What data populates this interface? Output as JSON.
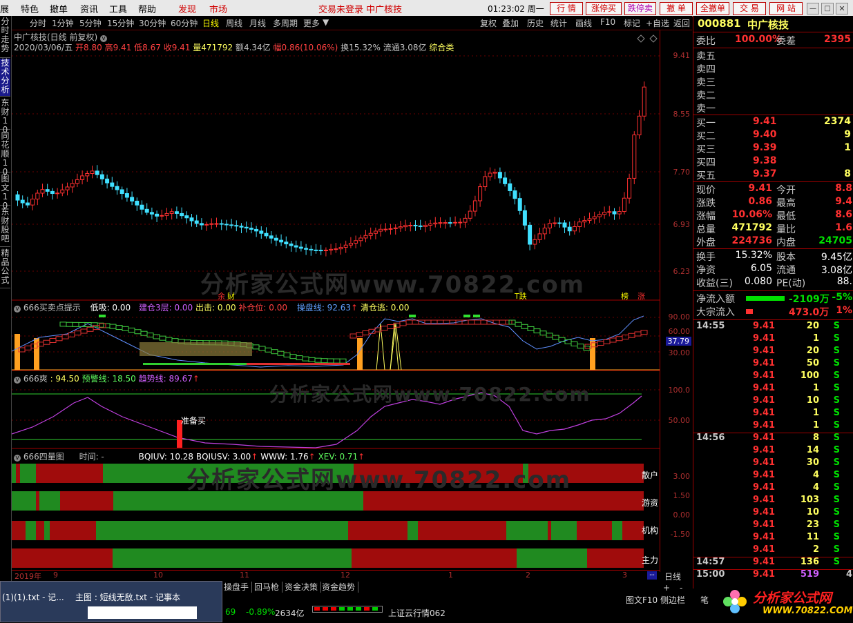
{
  "menu": {
    "items": [
      "展",
      "特色",
      "撤单",
      "资讯",
      "工具",
      "帮助"
    ],
    "red_items": [
      "发现",
      "市场"
    ],
    "notice": "交易未登录 中广核技",
    "time": "01:23:02 周一",
    "buttons": [
      "行 情",
      "涨停买",
      "跌停卖",
      "撤 单",
      "全撤单",
      "交 易",
      "网 站"
    ]
  },
  "sidebar": [
    "分时走势",
    "技术分析",
    "东财10",
    "同花顺10",
    "图文10",
    "东财股吧",
    "精品公式"
  ],
  "periods": [
    "分时",
    "1分钟",
    "5分钟",
    "15分钟",
    "30分钟",
    "60分钟",
    "日线",
    "周线",
    "月线",
    "多周期",
    "更多"
  ],
  "active_period": "日线",
  "toolbar": [
    "复权",
    "叠加",
    "历史",
    "统计",
    "画线",
    "F10",
    "标记",
    "+自选",
    "返回"
  ],
  "main_chart": {
    "title": "中广核技(日线 前复权)",
    "info": {
      "date": "2020/03/06/五",
      "open": "开8.80",
      "high": "高9.41",
      "low": "低8.67",
      "close": "收9.41",
      "vol": "量471792",
      "amount": "额4.34亿",
      "change": "幅0.86(10.06%)",
      "turnover": "换15.32%",
      "float": "流通3.08亿",
      "category": "综合类"
    },
    "yticks": [
      "9.41",
      "8.55",
      "7.70",
      "6.93",
      "6.23"
    ],
    "marks": [
      "余",
      "财",
      "T跌",
      "榜",
      "涨"
    ]
  },
  "panel1": {
    "title": "666买卖点提示",
    "items": [
      {
        "label": "低吸: 0.00",
        "color": "#ffffff"
      },
      {
        "label": "建仓3层: 0.00",
        "color": "#d060ff"
      },
      {
        "label": "出击: 0.00",
        "color": "#ffff60"
      },
      {
        "label": "补仓位: 0.00",
        "color": "#ff4040"
      },
      {
        "label": "操盘线: 92.63",
        "color": "#60a0ff"
      },
      {
        "label": "清仓逃: 0.00",
        "color": "#ffff60"
      }
    ],
    "yticks": [
      "90.00",
      "60.00",
      "37.79",
      "30.00"
    ]
  },
  "panel2": {
    "title": "666爽",
    "items": [
      {
        "label": ": 94.50",
        "color": "#ffff60"
      },
      {
        "label": "预警线: 18.50",
        "color": "#60ff60"
      },
      {
        "label": "趋势线: 89.67",
        "color": "#d060ff"
      }
    ],
    "yticks": [
      "100.0",
      "50.00"
    ],
    "signal": "准备买"
  },
  "panel3": {
    "title": "666四量图",
    "time_label": "时间: -",
    "items": [
      {
        "label": "BQIUV: 10.28",
        "color": "#ffffff"
      },
      {
        "label": "BQIUSV: 3.00",
        "color": "#ffffff"
      },
      {
        "label": "WWW: 1.76",
        "color": "#ffffff"
      },
      {
        "label": "XEV: 0.71",
        "color": "#60ff60"
      }
    ],
    "rows": [
      "散户",
      "游资",
      "机构",
      "主力"
    ],
    "yticks": [
      "3.00",
      "1.50",
      "0.00",
      "-1.50"
    ]
  },
  "xaxis": [
    "2019年",
    "9",
    "10",
    "11",
    "12",
    "1",
    "2",
    "3"
  ],
  "xaxis_corner": "日线",
  "stock": {
    "code": "000881",
    "name": "中广核技",
    "weibi_label": "委比",
    "weibi": "100.00%",
    "weicha_label": "委差",
    "weicha": "2395",
    "sells": [
      {
        "l": "卖五"
      },
      {
        "l": "卖四"
      },
      {
        "l": "卖三"
      },
      {
        "l": "卖二"
      },
      {
        "l": "卖一"
      }
    ],
    "buys": [
      {
        "l": "买一",
        "p": "9.41",
        "v": "2374"
      },
      {
        "l": "买二",
        "p": "9.40",
        "v": "9"
      },
      {
        "l": "买三",
        "p": "9.39",
        "v": "1"
      },
      {
        "l": "买四",
        "p": "9.38",
        "v": ""
      },
      {
        "l": "买五",
        "p": "9.37",
        "v": "8"
      }
    ],
    "quote": [
      {
        "l1": "现价",
        "v1": "9.41",
        "l2": "今开",
        "v2": "8.8"
      },
      {
        "l1": "涨跌",
        "v1": "0.86",
        "l2": "最高",
        "v2": "9.4"
      },
      {
        "l1": "涨幅",
        "v1": "10.06%",
        "l2": "最低",
        "v2": "8.6"
      },
      {
        "l1": "总量",
        "v1": "471792",
        "l2": "量比",
        "v2": "1.6"
      },
      {
        "l1": "外盘",
        "v1": "224736",
        "l2": "内盘",
        "v2": "24705"
      }
    ],
    "fund": [
      {
        "l1": "换手",
        "v1": "15.32%",
        "l2": "股本",
        "v2": "9.45亿"
      },
      {
        "l1": "净资",
        "v1": "6.05",
        "l2": "流通",
        "v2": "3.08亿"
      },
      {
        "l1": "收益(三)",
        "v1": "0.080",
        "l2": "PE(动)",
        "v2": "88."
      }
    ],
    "netflow_label": "净流入额",
    "netflow": "-2109万",
    "netflow_pct": "-5%",
    "big_label": "大宗流入",
    "big": "473.0万",
    "big_pct": "1%"
  },
  "ticks": [
    {
      "t": "14:55",
      "p": "9.41",
      "v": "20",
      "s": "S"
    },
    {
      "t": "",
      "p": "9.41",
      "v": "1",
      "s": "S"
    },
    {
      "t": "",
      "p": "9.41",
      "v": "20",
      "s": "S"
    },
    {
      "t": "",
      "p": "9.41",
      "v": "50",
      "s": "S"
    },
    {
      "t": "",
      "p": "9.41",
      "v": "100",
      "s": "S"
    },
    {
      "t": "",
      "p": "9.41",
      "v": "1",
      "s": "S"
    },
    {
      "t": "",
      "p": "9.41",
      "v": "10",
      "s": "S"
    },
    {
      "t": "",
      "p": "9.41",
      "v": "1",
      "s": "S"
    },
    {
      "t": "",
      "p": "9.41",
      "v": "1",
      "s": "S"
    },
    {
      "t": "14:56",
      "p": "9.41",
      "v": "8",
      "s": "S"
    },
    {
      "t": "",
      "p": "9.41",
      "v": "14",
      "s": "S"
    },
    {
      "t": "",
      "p": "9.41",
      "v": "30",
      "s": "S"
    },
    {
      "t": "",
      "p": "9.41",
      "v": "4",
      "s": "S"
    },
    {
      "t": "",
      "p": "9.41",
      "v": "4",
      "s": "S"
    },
    {
      "t": "",
      "p": "9.41",
      "v": "103",
      "s": "S"
    },
    {
      "t": "",
      "p": "9.41",
      "v": "10",
      "s": "S"
    },
    {
      "t": "",
      "p": "9.41",
      "v": "23",
      "s": "S"
    },
    {
      "t": "",
      "p": "9.41",
      "v": "11",
      "s": "S"
    },
    {
      "t": "",
      "p": "9.41",
      "v": "2",
      "s": "S"
    },
    {
      "t": "14:57",
      "p": "9.41",
      "v": "136",
      "s": "S"
    },
    {
      "t": "15:00",
      "p": "9.41",
      "v": "519",
      "s": "4"
    }
  ],
  "bottom_tabs": [
    "操盘手",
    "回马枪",
    "资金决策",
    "资金趋势"
  ],
  "status": {
    "index_val": "69",
    "index_pct": "-0.89%",
    "index_amt": "2634亿",
    "ticker_label": "上证云行情062",
    "right_links": [
      "图文F10",
      "侧边栏",
      "笔"
    ],
    "popup_lines": [
      "(1)(1).txt - 记...",
      "主图 : 短线无敌.txt - 记事本"
    ]
  },
  "watermark": "分析家公式网www.70822.com",
  "logo": {
    "text": "分析家公式网",
    "url": "WWW.70822.COM"
  }
}
